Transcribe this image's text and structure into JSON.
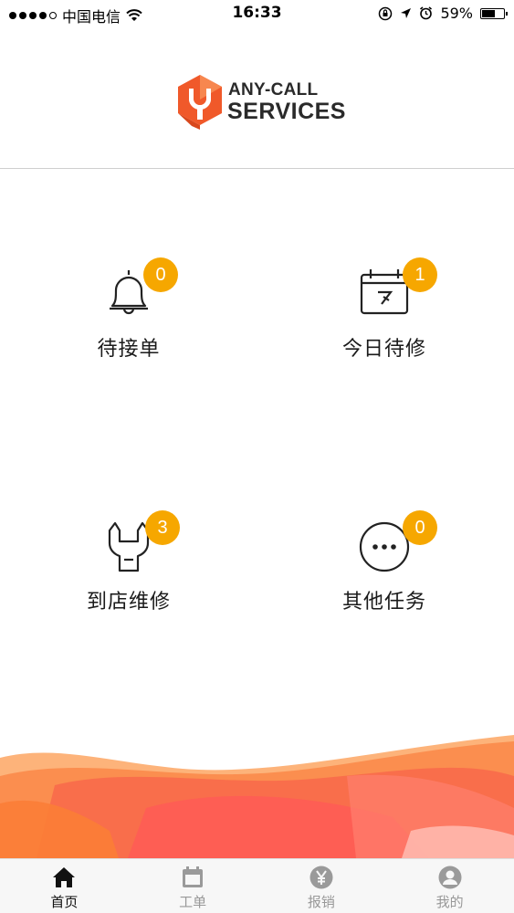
{
  "status_bar": {
    "carrier": "中国电信",
    "time": "16:33",
    "battery": "59%"
  },
  "brand": {
    "line1": "ANY-CALL",
    "line2": "SERVICES"
  },
  "tiles": [
    {
      "label": "待接单",
      "count": "0",
      "icon": "bell-icon"
    },
    {
      "label": "今日待修",
      "count": "1",
      "icon": "calendar-today-icon"
    },
    {
      "label": "到店维修",
      "count": "3",
      "icon": "wrench-icon"
    },
    {
      "label": "其他任务",
      "count": "0",
      "icon": "more-dots-icon"
    }
  ],
  "tabbar": [
    {
      "label": "首页",
      "icon": "home-icon",
      "active": true
    },
    {
      "label": "工单",
      "icon": "calendar-icon",
      "active": false
    },
    {
      "label": "报销",
      "icon": "yen-icon",
      "active": false
    },
    {
      "label": "我的",
      "icon": "user-icon",
      "active": false
    }
  ],
  "colors": {
    "accent": "#f6a700",
    "brand_orange": "#f0592a"
  }
}
